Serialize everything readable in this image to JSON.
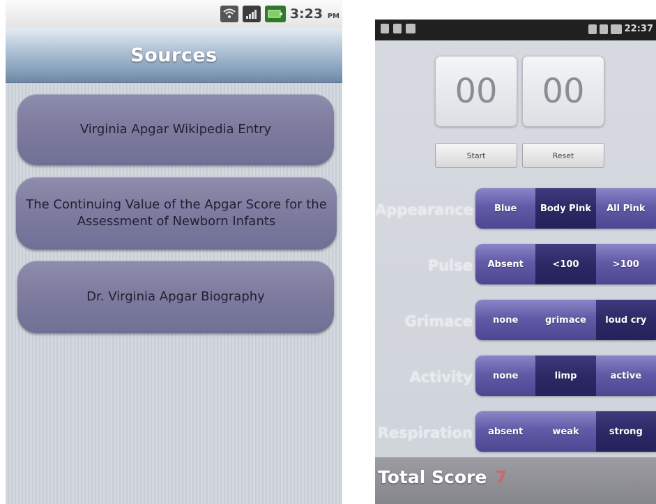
{
  "left_screen": {
    "status_bar": {
      "time": "3:23",
      "ampm": "PM",
      "icons": [
        "wifi-icon",
        "signal-icon",
        "battery-icon"
      ]
    },
    "title": "Sources",
    "sources": [
      {
        "label": "Virginia Apgar Wikipedia Entry"
      },
      {
        "label": "The Continuing Value of the Apgar Score for the Assessment of Newborn Infants"
      },
      {
        "label": "Dr. Virginia Apgar Biography"
      }
    ],
    "colors": {
      "button": "#7f7ea1",
      "title_bar": "#8aa3bd"
    }
  },
  "right_screen": {
    "status_bar": {
      "time": "22:37"
    },
    "timer": {
      "minutes": "00",
      "seconds": "00"
    },
    "controls": {
      "start_label": "Start",
      "reset_label": "Reset"
    },
    "criteria": [
      {
        "label": "Appearance",
        "options": [
          "Blue",
          "Body Pink",
          "All Pink"
        ],
        "selected": 1
      },
      {
        "label": "Pulse",
        "options": [
          "Absent",
          "<100",
          ">100"
        ],
        "selected": 1
      },
      {
        "label": "Grimace",
        "options": [
          "none",
          "grimace",
          "loud cry"
        ],
        "selected": 2
      },
      {
        "label": "Activity",
        "options": [
          "none",
          "limp",
          "active"
        ],
        "selected": 1
      },
      {
        "label": "Respiration",
        "options": [
          "absent",
          "weak",
          "strong"
        ],
        "selected": 2
      }
    ],
    "total_score": {
      "label": "Total Score",
      "value": "7"
    },
    "colors": {
      "segment": "#615ba7",
      "segment_selected": "#2d2966",
      "score": "#c96a6f"
    }
  }
}
